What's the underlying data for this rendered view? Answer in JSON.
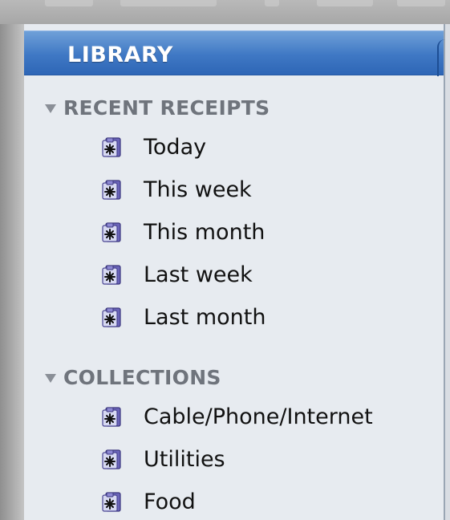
{
  "sidebar": {
    "library": {
      "label": "LIBRARY"
    },
    "sections": [
      {
        "title": "RECENT RECEIPTS",
        "items": [
          {
            "label": "Today",
            "icon": "smart-collection-icon"
          },
          {
            "label": "This week",
            "icon": "smart-collection-icon"
          },
          {
            "label": "This month",
            "icon": "smart-collection-icon"
          },
          {
            "label": "Last week",
            "icon": "smart-collection-icon"
          },
          {
            "label": "Last month",
            "icon": "smart-collection-icon"
          }
        ]
      },
      {
        "title": "COLLECTIONS",
        "items": [
          {
            "label": "Cable/Phone/Internet",
            "icon": "smart-collection-icon"
          },
          {
            "label": "Utilities",
            "icon": "smart-collection-icon"
          },
          {
            "label": "Food",
            "icon": "smart-collection-icon"
          }
        ]
      }
    ]
  },
  "colors": {
    "selection_blue": "#3f78c4",
    "sidebar_bg": "#e7ebf0",
    "header_gray": "#6f747c"
  }
}
